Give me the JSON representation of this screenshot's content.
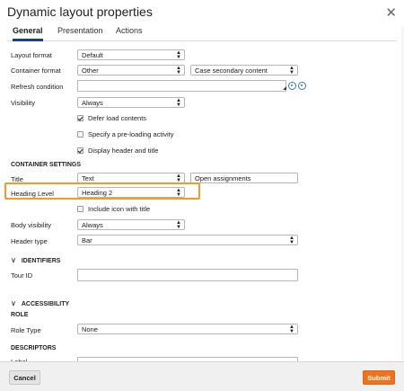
{
  "dialog": {
    "title": "Dynamic layout properties",
    "close_icon": "close-icon"
  },
  "tabs": [
    {
      "label": "General",
      "active": true
    },
    {
      "label": "Presentation",
      "active": false
    },
    {
      "label": "Actions",
      "active": false
    }
  ],
  "fields": {
    "layout_format": {
      "label": "Layout format",
      "value": "Default"
    },
    "container_format": {
      "label": "Container format",
      "value": "Other",
      "secondary_value": "Case secondary content"
    },
    "refresh_condition": {
      "label": "Refresh condition",
      "value": ""
    },
    "visibility": {
      "label": "Visibility",
      "value": "Always"
    }
  },
  "checkboxes": [
    {
      "label": "Defer load contents",
      "checked": true
    },
    {
      "label": "Specify a pre-loading activity",
      "checked": false
    },
    {
      "label": "Display header and title",
      "checked": true
    }
  ],
  "container_settings": {
    "heading": "CONTAINER SETTINGS",
    "title": {
      "label": "Title",
      "value": "Text",
      "text_value": "Open assignments"
    },
    "heading_level": {
      "label": "Heading Level",
      "value": "Heading 2"
    },
    "include_icon": {
      "label": "Include icon with title",
      "checked": false
    },
    "body_visibility": {
      "label": "Body visibility",
      "value": "Always"
    },
    "header_type": {
      "label": "Header type",
      "value": "Bar"
    }
  },
  "identifiers": {
    "heading": "IDENTIFIERS",
    "tour_id": {
      "label": "Tour ID",
      "value": ""
    }
  },
  "accessibility": {
    "heading": "ACCESSIBILITY",
    "role_heading": "ROLE",
    "role_type": {
      "label": "Role Type",
      "value": "None"
    },
    "descriptors_heading": "DESCRIPTORS",
    "label_partial": "Label"
  },
  "footer": {
    "cancel_label": "Cancel",
    "submit_label": "Submit"
  },
  "colors": {
    "accent": "#1a3e8c",
    "highlight": "#f39a2f",
    "submit": "#f0721e"
  }
}
